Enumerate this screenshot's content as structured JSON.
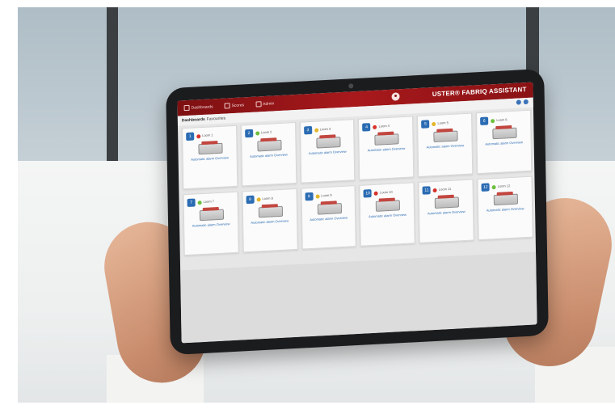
{
  "app": {
    "brand": "USTER® FABRIQ ASSISTANT",
    "nav": [
      {
        "label": "Dashboards",
        "icon": "home-icon"
      },
      {
        "label": "Scores",
        "icon": "chart-icon"
      },
      {
        "label": "Admin",
        "icon": "tools-icon"
      }
    ],
    "breadcrumb": {
      "current": "Dashboards",
      "section": "Favourites"
    }
  },
  "cards": [
    {
      "badge": "1",
      "status_color": "#d6332c",
      "name": "Loom 1",
      "text": "Automatic alarm Overview"
    },
    {
      "badge": "2",
      "status_color": "#6cbf3d",
      "name": "Loom 2",
      "text": "Automatic alarm Overview"
    },
    {
      "badge": "3",
      "status_color": "#e3b62a",
      "name": "Loom 3",
      "text": "Automatic alarm Overview"
    },
    {
      "badge": "4",
      "status_color": "#d6332c",
      "name": "Loom 4",
      "text": "Automatic alarm Overview"
    },
    {
      "badge": "5",
      "status_color": "#e3b62a",
      "name": "Loom 5",
      "text": "Automatic alarm Overview"
    },
    {
      "badge": "6",
      "status_color": "#6cbf3d",
      "name": "Loom 6",
      "text": "Automatic alarm Overview"
    },
    {
      "badge": "7",
      "status_color": "#6cbf3d",
      "name": "Loom 7",
      "text": "Automatic alarm Overview"
    },
    {
      "badge": "8",
      "status_color": "#e3b62a",
      "name": "Loom 8",
      "text": "Automatic alarm Overview"
    },
    {
      "badge": "9",
      "status_color": "#e3b62a",
      "name": "Loom 9",
      "text": "Automatic alarm Overview"
    },
    {
      "badge": "10",
      "status_color": "#d6332c",
      "name": "Loom 10",
      "text": "Automatic alarm Overview"
    },
    {
      "badge": "11",
      "status_color": "#d6332c",
      "name": "Loom 11",
      "text": "Automatic alarm Overview"
    },
    {
      "badge": "12",
      "status_color": "#6cbf3d",
      "name": "Loom 12",
      "text": "Automatic alarm Overview"
    }
  ],
  "colors": {
    "brand_red": "#a8191c",
    "accent_blue": "#2b6cb3"
  }
}
